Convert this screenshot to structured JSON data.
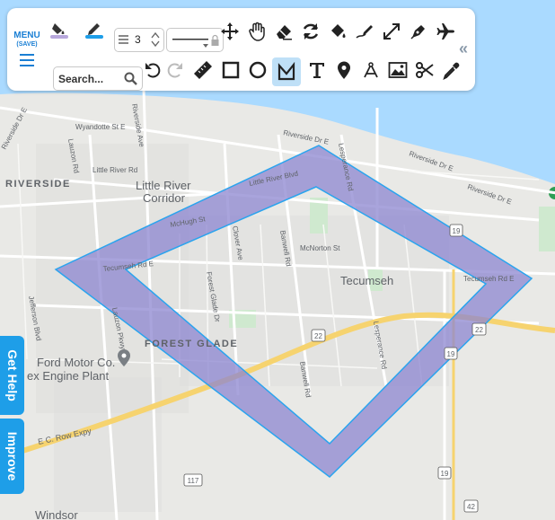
{
  "toolbar": {
    "menu_label": "MENU",
    "menu_sub": "(SAVE)",
    "line_width": "3",
    "search_placeholder": "Search...",
    "tools_row1": [
      "fill-color-icon",
      "line-color-icon",
      "move-icon",
      "pan-hand-icon",
      "eraser-icon",
      "refresh-icon",
      "paint-bucket-icon",
      "freehand-icon",
      "resize-icon",
      "pen-icon",
      "airplane-icon"
    ],
    "tools_row2": [
      "undo-icon",
      "redo-icon",
      "ruler-icon",
      "rectangle-icon",
      "circle-icon",
      "polygon-icon",
      "text-icon",
      "marker-icon",
      "compass-icon",
      "image-icon",
      "scissors-icon",
      "eyedropper-icon"
    ],
    "active_tool": "polygon-icon",
    "collapse": "«"
  },
  "side": {
    "help": "Get Help",
    "improve": "Improve"
  },
  "map": {
    "colors": {
      "water": "#aadaff",
      "land": "#e9e9e6",
      "urban": "#e3e3e0",
      "polygon_fill": "#8c86d0",
      "polygon_stroke": "#2aa4ee",
      "highway": "#f6d36f"
    },
    "labels": {
      "riverside": "RIVERSIDE",
      "little_river_1": "Little River",
      "little_river_2": "Corridor",
      "tecumseh": "Tecumseh",
      "forest_glade": "FOREST GLADE",
      "ford_1": "Ford Motor Co.",
      "ford_2": "ex Engine Plant",
      "windsor": "Windsor",
      "riverside_dr_1": "Riverside Dr E",
      "riverside_dr_2": "Riverside Dr E",
      "riverside_dr_3": "Riverside Dr E",
      "riverside_dr_4": "Riverside Dr E",
      "riverside_ave": "Riverside Ave",
      "wyandotte": "Wyandotte St E",
      "little_river_rd": "Little River Rd",
      "little_river_blvd": "Little River Blvd",
      "lauzon_rd": "Lauzon Rd",
      "lesperance_rd_1": "Lesperance Rd",
      "lesperance_rd_2": "Lesperance Rd",
      "mchugh": "McHugh St",
      "mcnorton": "McNorton St",
      "clover": "Clover Ave",
      "banwell_1": "Banwell Rd",
      "banwell_2": "Banwell Rd",
      "tecumseh_rd_w": "Tecumseh Rd E",
      "tecumseh_rd_e": "Tecumseh Rd E",
      "forest_glade_dr": "Forest Glade Dr",
      "jefferson": "Jefferson Blvd",
      "lauzon_pkwy": "Lauzon Pkwy",
      "ec_row": "E C. Row Expy",
      "shield_22a": "22",
      "shield_22b": "22",
      "shield_19a": "19",
      "shield_19b": "19",
      "shield_19c": "19",
      "shield_117": "117",
      "shield_42": "42"
    }
  }
}
